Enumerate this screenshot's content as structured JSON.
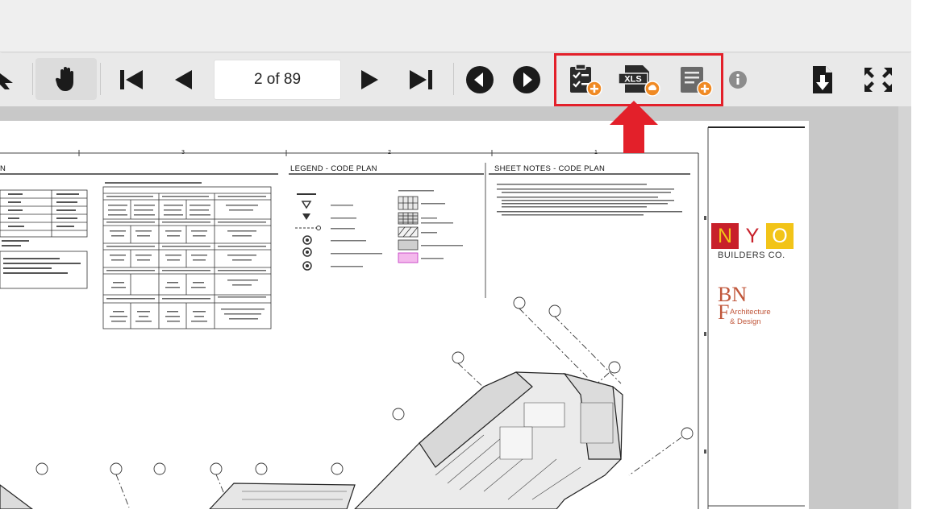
{
  "toolbar": {
    "page_indicator": "2 of 89"
  },
  "sheet": {
    "column_numbers": [
      "3",
      "2",
      "1"
    ],
    "partial_title": "N",
    "legend_title": "LEGEND - CODE PLAN",
    "notes_title": "SHEET NOTES - CODE PLAN"
  },
  "title_block": {
    "nyo_letters": [
      "N",
      "Y",
      "O"
    ],
    "nyo_subtitle": "BUILDERS CO.",
    "bnf_letters": "BN\nF",
    "bnf_subtitle_line1": "Architecture",
    "bnf_subtitle_line2": "& Design"
  },
  "colors": {
    "highlight": "#e3202a",
    "addon_badge": "#f08a24",
    "nyo_red": "#c8202a",
    "nyo_yellow": "#f2c418",
    "bnf_brown": "#c0563a"
  },
  "icons": [
    "select-arrow-icon",
    "hand-pan-icon",
    "first-page-icon",
    "previous-page-icon",
    "next-page-icon",
    "last-page-icon",
    "circle-back-icon",
    "circle-forward-icon",
    "checklist-add-icon",
    "xls-export-icon",
    "document-add-icon",
    "info-icon",
    "download-icon",
    "fullscreen-icon"
  ]
}
